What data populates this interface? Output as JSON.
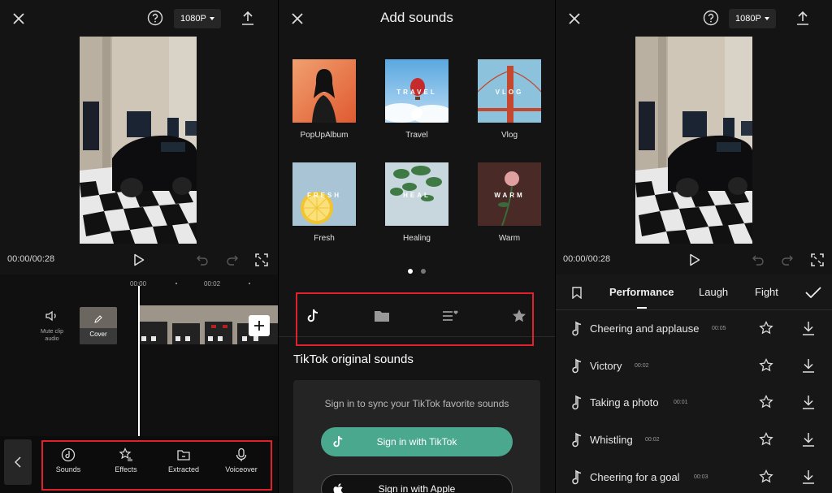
{
  "left_panel": {
    "resolution": "1080P",
    "time": "00:00/00:28",
    "ruler": [
      "00:00",
      "00:02"
    ],
    "mute_label": "Mute clip audio",
    "cover_label": "Cover",
    "tools": [
      {
        "label": "Sounds",
        "icon": "sounds-icon"
      },
      {
        "label": "Effects",
        "icon": "effects-icon"
      },
      {
        "label": "Extracted",
        "icon": "extracted-icon"
      },
      {
        "label": "Voiceover",
        "icon": "voiceover-icon"
      }
    ],
    "highlight_color": "#e0202a"
  },
  "middle_panel": {
    "title": "Add sounds",
    "albums": [
      {
        "name": "PopUpAlbum",
        "cover_text": ""
      },
      {
        "name": "Travel",
        "cover_text": "TRAVEL"
      },
      {
        "name": "Vlog",
        "cover_text": "VLOG"
      },
      {
        "name": "Fresh",
        "cover_text": "FRESH"
      },
      {
        "name": "Healing",
        "cover_text": "HEAL"
      },
      {
        "name": "Warm",
        "cover_text": "WARM"
      }
    ],
    "page_dots": {
      "count": 2,
      "active": 1
    },
    "tab_icons": [
      "tiktok-icon",
      "folder-icon",
      "playlist-favorite-icon",
      "star-icon"
    ],
    "section_title": "TikTok original sounds",
    "sync_text": "Sign in to sync your TikTok favorite sounds",
    "signin_tiktok": "Sign in with TikTok",
    "signin_apple": "Sign in with Apple",
    "accent_color": "#4aa88f"
  },
  "right_panel": {
    "resolution": "1080P",
    "time": "00:00/00:28",
    "categories": [
      "Performance",
      "Laugh",
      "Fight"
    ],
    "active_category": "Performance",
    "sounds": [
      {
        "name": "Cheering and applause",
        "duration": "00:05"
      },
      {
        "name": "Victory",
        "duration": "00:02"
      },
      {
        "name": "Taking a photo",
        "duration": "00:01"
      },
      {
        "name": "Whistling",
        "duration": "00:02"
      },
      {
        "name": "Cheering for a goal",
        "duration": "00:03"
      }
    ]
  }
}
